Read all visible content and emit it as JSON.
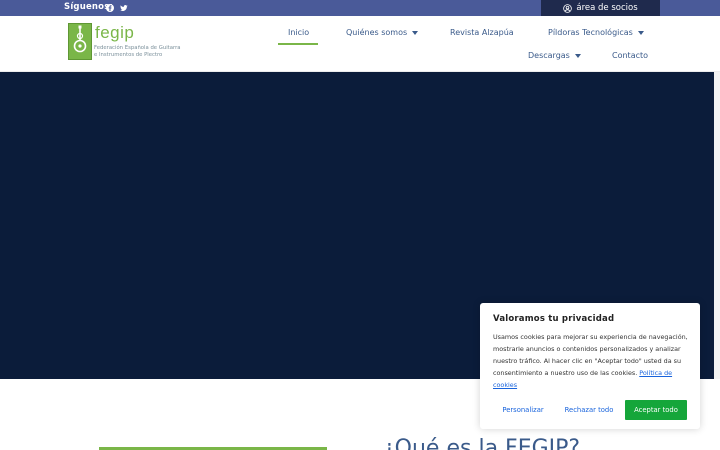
{
  "topbar": {
    "follow_label": "Síguenos:",
    "social_icons": [
      "facebook-icon",
      "twitter-icon"
    ],
    "members_label": "área de socios",
    "members_icon": "user-circle-icon"
  },
  "brand": {
    "name": "fegip",
    "subtitle_line1": "Federación Española de Guitarra",
    "subtitle_line2": "e Instrumentos de Plectro",
    "color": "#7ab648"
  },
  "nav": {
    "items": [
      {
        "label": "Inicio",
        "active": true,
        "dropdown": false
      },
      {
        "label": "Quiénes somos",
        "active": false,
        "dropdown": true
      },
      {
        "label": "Revista Alzapúa",
        "active": false,
        "dropdown": false
      },
      {
        "label": "Píldoras Tecnológicas",
        "active": false,
        "dropdown": true
      },
      {
        "label": "Descargas",
        "active": false,
        "dropdown": true
      },
      {
        "label": "Contacto",
        "active": false,
        "dropdown": false
      }
    ]
  },
  "section": {
    "title": "¿Qué es la FEGIP?"
  },
  "cookie": {
    "title": "Valoramos tu privacidad",
    "text": "Usamos cookies para mejorar su experiencia de navegación, mostrarle anuncios o contenidos personalizados y analizar nuestro tráfico. Al hacer clic en \"Aceptar todo\" usted da su consentimiento a nuestro uso de las cookies.",
    "link": "Política de cookies",
    "buttons": {
      "customize": "Personalizar",
      "reject": "Rechazar todo",
      "accept": "Aceptar todo"
    }
  },
  "colors": {
    "topbar": "#4a5a99",
    "members_bg": "#1f2a4d",
    "hero": "#0b1c3a",
    "nav_text": "#3a5a8a",
    "accent_green": "#7ab648",
    "accept_button": "#15a63a",
    "link_blue": "#1863dc"
  }
}
